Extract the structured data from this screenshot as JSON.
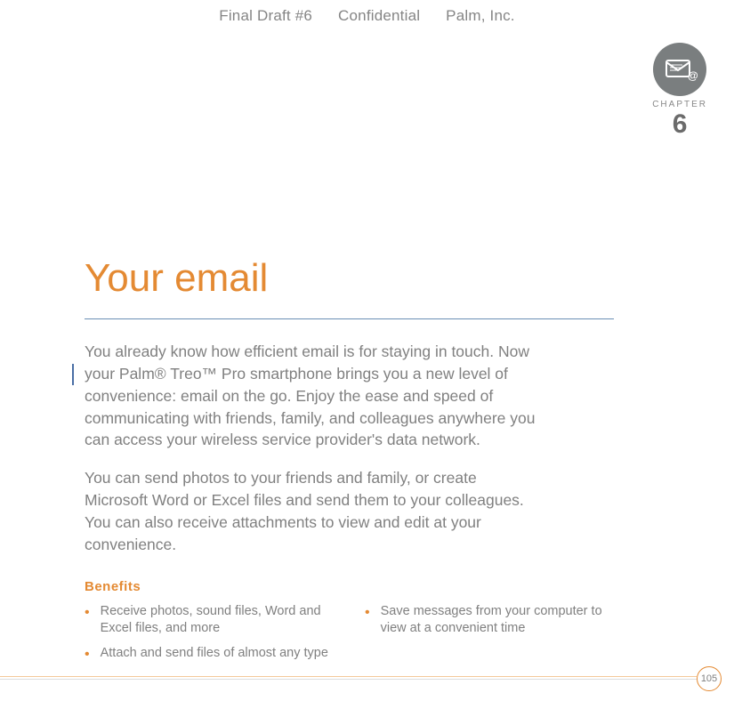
{
  "header": {
    "draft": "Final Draft #6",
    "confidential": "Confidential",
    "company": "Palm, Inc."
  },
  "chapter": {
    "label": "CHAPTER",
    "number": "6"
  },
  "title": "Your email",
  "paragraphs": {
    "p1": "You already know how efficient email is for staying in touch. Now your Palm® Treo™ Pro smartphone brings you a new level of convenience: email on the go. Enjoy the ease and speed of communicating with friends, family, and colleagues anywhere you can access your wireless service provider's data network.",
    "p2": "You can send photos to your friends and family, or create Microsoft Word or Excel files and send them to your colleagues. You can also receive attachments to view and edit at your convenience."
  },
  "benefits": {
    "heading": "Benefits",
    "left": [
      "Receive photos, sound files, Word and Excel files, and more",
      "Attach and send files of almost any type"
    ],
    "right": [
      "Save messages from your computer to view at a convenient time"
    ]
  },
  "pageNumber": "105"
}
